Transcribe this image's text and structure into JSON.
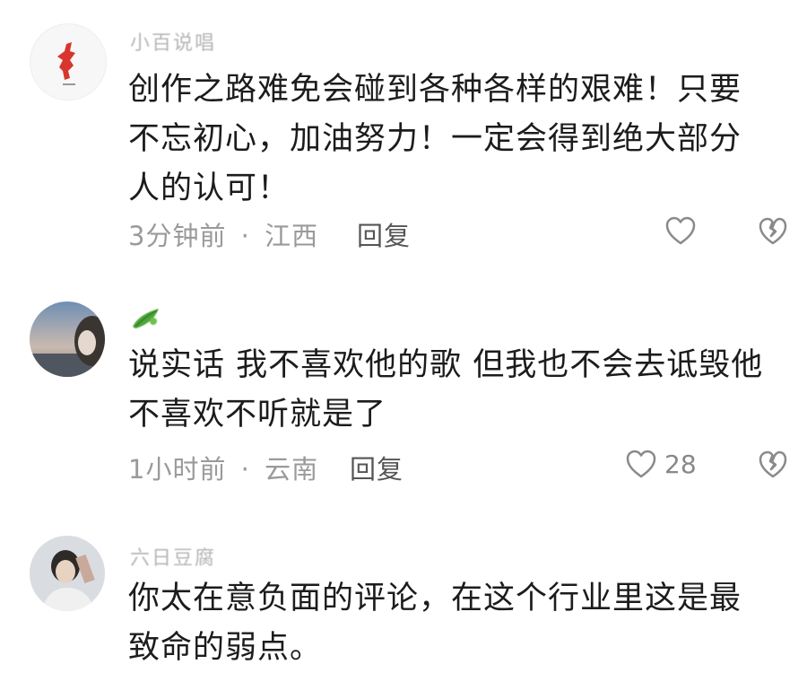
{
  "comments": [
    {
      "username": "小百说唱",
      "text": "创作之路难免会碰到各种各样的艰难！只要\n不忘初心，加油努力！一定会得到绝大部分\n人的认可！",
      "time": "3分钟前",
      "location": "江西",
      "reply_label": "回复",
      "like_count": "",
      "avatar_icon": "red-character-logo-icon"
    },
    {
      "username": "",
      "text": "说实话 我不喜欢他的歌 但我也不会去诋毁他\n不喜欢不听就是了",
      "time": "1小时前",
      "location": "云南",
      "reply_label": "回复",
      "like_count": "28",
      "avatar_icon": "sunset-photo-avatar-icon"
    },
    {
      "username": "六日豆腐",
      "text": "你太在意负面的评论，在这个行业里这是最\n致命的弱点。",
      "avatar_icon": "person-photo-avatar-icon"
    }
  ],
  "separator": "·",
  "colors": {
    "text": "#1c1c1c",
    "meta": "#9a9a9a",
    "username": "#b5b5b5",
    "icon": "#8a8a8a"
  }
}
